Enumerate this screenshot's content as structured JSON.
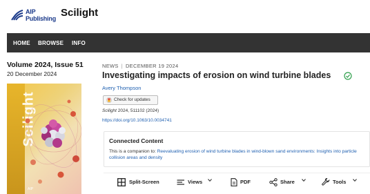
{
  "header": {
    "logo_line1": "AIP",
    "logo_line2": "Publishing",
    "site_name": "Scilight",
    "logo_color": "#1b3a8a"
  },
  "nav": {
    "items": [
      {
        "label": "HOME"
      },
      {
        "label": "BROWSE"
      },
      {
        "label": "INFO"
      }
    ],
    "bar_color": "#333333"
  },
  "issue": {
    "volume": "Volume 2024, Issue 51",
    "date": "20 December 2024",
    "cover_word": "Scilight"
  },
  "article": {
    "category": "NEWS",
    "date": "DECEMBER 19 2024",
    "title": "Investigating impacts of erosion on wind turbine blades",
    "author": "Avery Thompson",
    "check_updates_label": "Check for updates",
    "citation_journal": "Scilight",
    "citation_rest": "2024, 511102 (2024)",
    "doi": "https://doi.org/10.1063/10.0034741",
    "verified_icon": "check-circle-icon",
    "link_color": "#1e5fb0"
  },
  "connected": {
    "title": "Connected Content",
    "prefix": "This is a companion to:",
    "link": "Reevaluating erosion of wind turbine blades in wind-blown sand environments: Insights into particle collision areas and density"
  },
  "toolbar": {
    "split_screen": "Split-Screen",
    "views": "Views",
    "pdf": "PDF",
    "share": "Share",
    "tools": "Tools"
  }
}
